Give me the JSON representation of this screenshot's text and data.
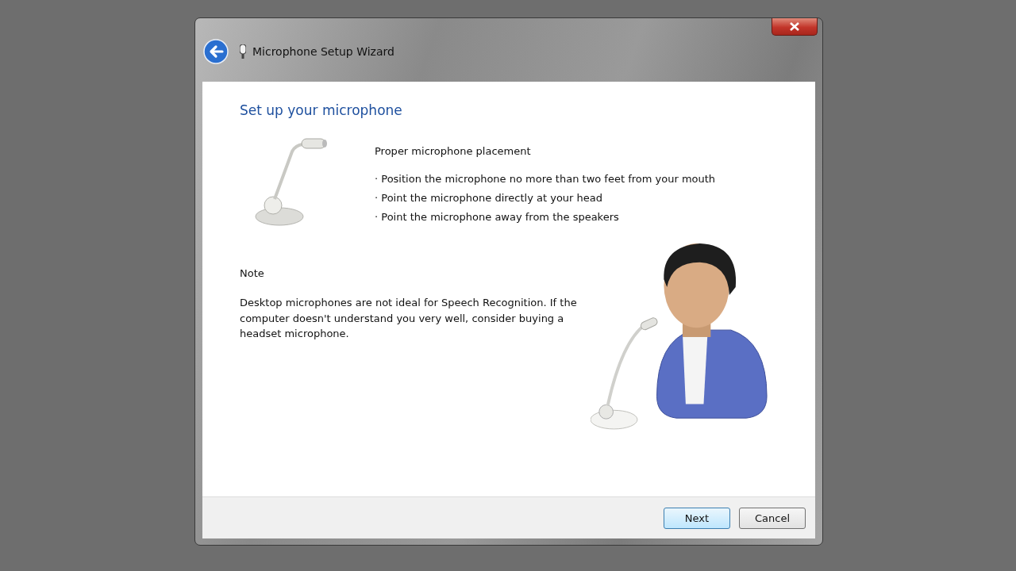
{
  "window": {
    "title": "Microphone Setup Wizard"
  },
  "heading": "Set up your microphone",
  "placement": {
    "title": "Proper microphone placement",
    "tips": [
      "· Position the microphone no more than two feet from your mouth",
      "· Point the microphone directly at your head",
      "· Point the microphone away from the speakers"
    ]
  },
  "note": {
    "title": "Note",
    "text": "Desktop microphones are not ideal for Speech Recognition. If the computer doesn't understand you very well, consider buying a headset microphone."
  },
  "buttons": [
    {
      "label": "Next",
      "default": true
    },
    {
      "label": "Cancel",
      "default": false
    }
  ]
}
